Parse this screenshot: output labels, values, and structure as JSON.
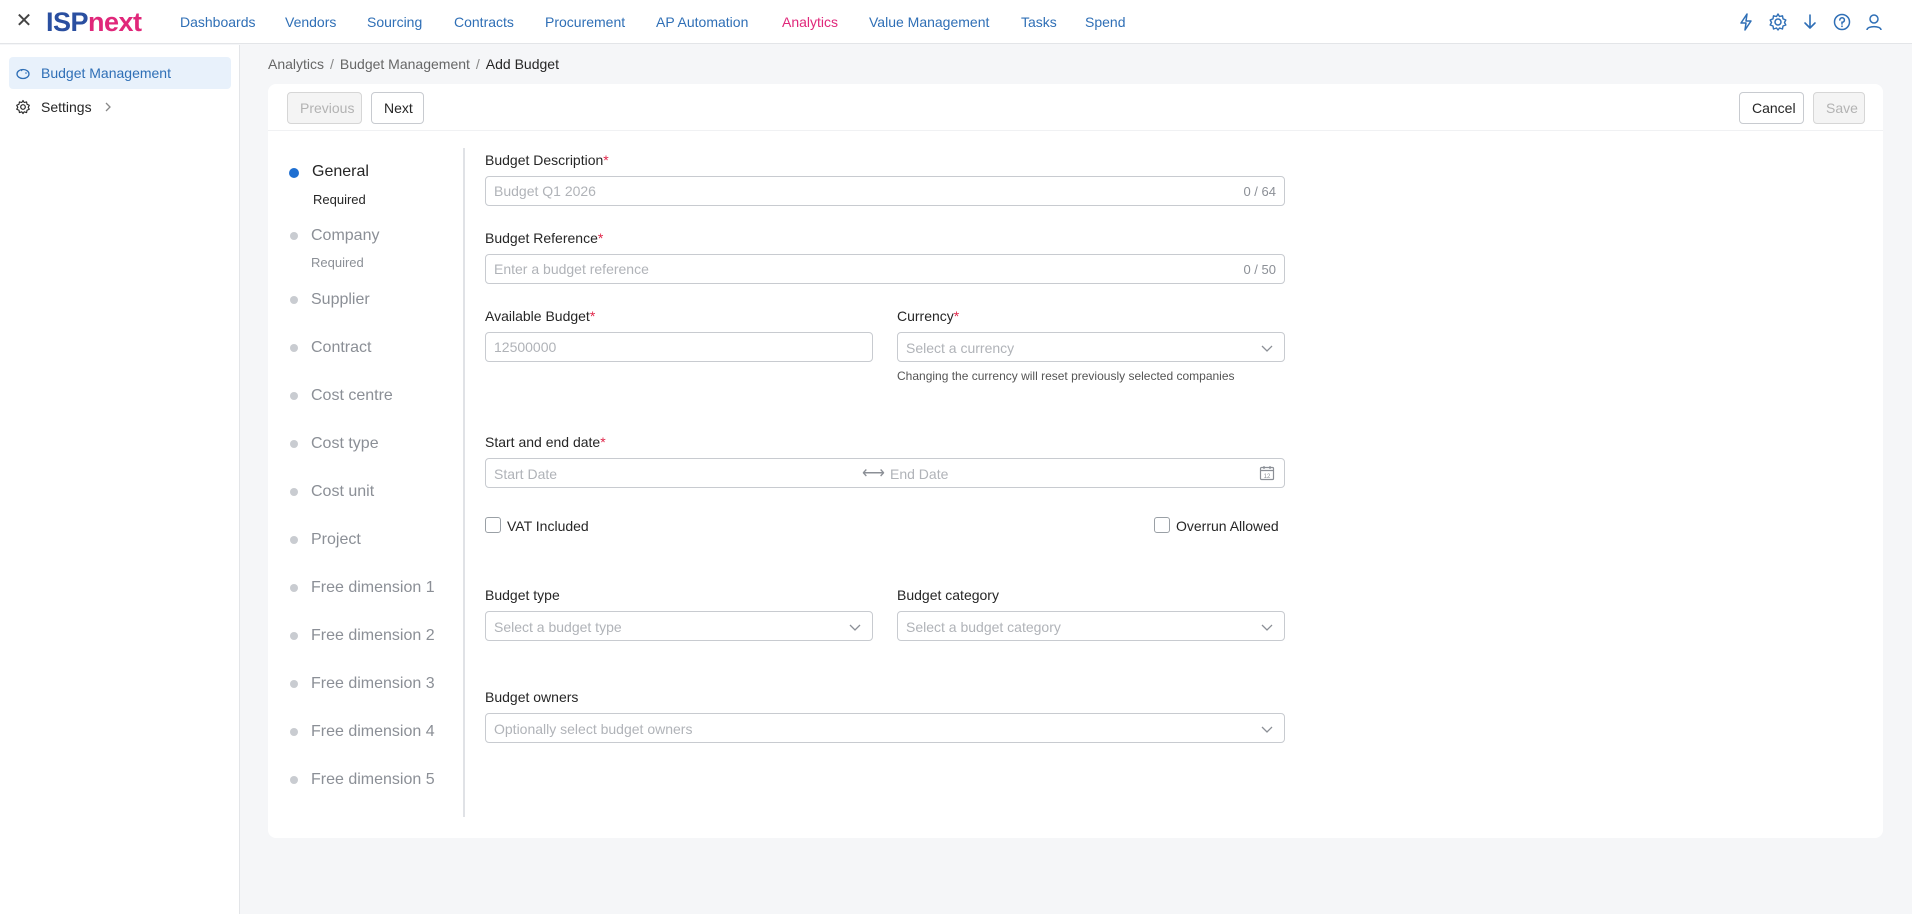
{
  "app": {
    "logo_part1": "ISP",
    "logo_part2": "next"
  },
  "nav": {
    "items": [
      {
        "label": "Dashboards"
      },
      {
        "label": "Vendors"
      },
      {
        "label": "Sourcing"
      },
      {
        "label": "Contracts"
      },
      {
        "label": "Procurement"
      },
      {
        "label": "AP Automation"
      },
      {
        "label": "Analytics",
        "active": true
      },
      {
        "label": "Value Management"
      },
      {
        "label": "Tasks"
      },
      {
        "label": "Spend"
      }
    ],
    "icons": [
      "lightning-icon",
      "gear-icon",
      "download-icon",
      "help-icon",
      "user-icon"
    ],
    "active_color": "#e0277a",
    "link_color": "#2f6fb6"
  },
  "sidebar": {
    "items": [
      {
        "label": "Budget Management",
        "icon": "piggy-bank-icon",
        "selected": true
      },
      {
        "label": "Settings",
        "icon": "gear-icon"
      }
    ]
  },
  "breadcrumb": {
    "items": [
      "Analytics",
      "Budget Management",
      "Add Budget"
    ],
    "separator": "/"
  },
  "toolbar": {
    "previous_label": "Previous",
    "next_label": "Next",
    "cancel_label": "Cancel",
    "save_label": "Save"
  },
  "steps": [
    {
      "title": "General",
      "sub": "Required",
      "active": true
    },
    {
      "title": "Company",
      "sub": "Required"
    },
    {
      "title": "Supplier"
    },
    {
      "title": "Contract"
    },
    {
      "title": "Cost centre"
    },
    {
      "title": "Cost type"
    },
    {
      "title": "Cost unit"
    },
    {
      "title": "Project"
    },
    {
      "title": "Free dimension 1"
    },
    {
      "title": "Free dimension 2"
    },
    {
      "title": "Free dimension 3"
    },
    {
      "title": "Free dimension 4"
    },
    {
      "title": "Free dimension 5"
    }
  ],
  "form": {
    "description": {
      "label": "Budget Description",
      "required_mark": "*",
      "placeholder": "Budget Q1 2026",
      "value": "",
      "counter": "0 / 64"
    },
    "reference": {
      "label": "Budget Reference",
      "required_mark": "*",
      "placeholder": "Enter a budget reference",
      "value": "",
      "counter": "0 / 50"
    },
    "available": {
      "label": "Available Budget",
      "required_mark": "*",
      "placeholder": "12500000",
      "value": ""
    },
    "currency": {
      "label": "Currency",
      "required_mark": "*",
      "placeholder": "Select a currency",
      "hint": "Changing the currency will reset previously selected companies"
    },
    "dates": {
      "label": "Start and end date",
      "required_mark": "*",
      "start_placeholder": "Start Date",
      "end_placeholder": "End Date",
      "arrow": "⟷"
    },
    "vat": {
      "label": "VAT Included",
      "checked": false
    },
    "overrun": {
      "label": "Overrun Allowed",
      "checked": false
    },
    "budget_type": {
      "label": "Budget type",
      "placeholder": "Select a budget type"
    },
    "budget_category": {
      "label": "Budget category",
      "placeholder": "Select a budget category"
    },
    "owners": {
      "label": "Budget owners",
      "placeholder": "Optionally select budget owners"
    }
  }
}
